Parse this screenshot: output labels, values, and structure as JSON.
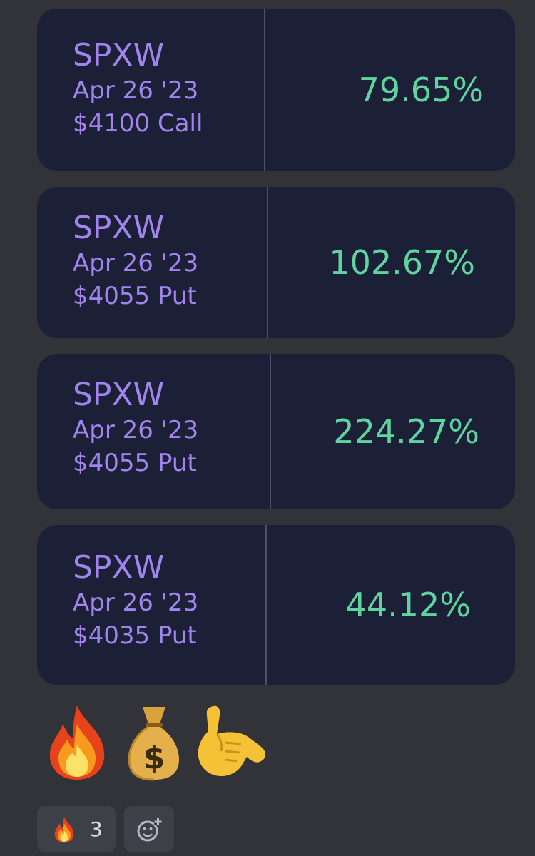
{
  "cards": [
    {
      "symbol": "SPXW",
      "date": "Apr 26 '23",
      "contract": "$4100 Call",
      "percent": "79.65%"
    },
    {
      "symbol": "SPXW",
      "date": "Apr 26 '23",
      "contract": "$4055 Put",
      "percent": "102.67%"
    },
    {
      "symbol": "SPXW",
      "date": "Apr 26 '23",
      "contract": "$4055 Put",
      "percent": "224.27%"
    },
    {
      "symbol": "SPXW",
      "date": "Apr 26 '23",
      "contract": "$4035 Put",
      "percent": "44.12%"
    }
  ],
  "message_emojis": [
    "fire-icon",
    "money-bag-icon",
    "call-me-hand-icon"
  ],
  "reactions": {
    "fire": {
      "emoji": "fire-icon",
      "count": "3"
    },
    "add_reaction": {
      "icon": "add-reaction-icon"
    }
  },
  "colors": {
    "background": "#313338",
    "card": "#1b2036",
    "symbol_text": "#a184ee",
    "percent_text": "#5fd3a0"
  }
}
